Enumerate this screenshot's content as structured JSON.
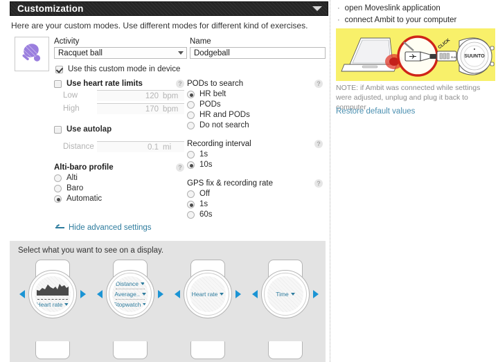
{
  "header": {
    "title": "Customization",
    "collapse_icon": "caret-down-icon"
  },
  "intro": "Here are your custom modes. Use different modes for different kind of exercises.",
  "activity": {
    "icon": "racquet-ball-icon",
    "label": "Activity",
    "value": "Racquet ball"
  },
  "name": {
    "label": "Name",
    "value": "Dodgeball"
  },
  "use_custom_mode": {
    "label": "Use this custom mode in device",
    "checked": true
  },
  "heart_rate_limits": {
    "label": "Use heart rate limits",
    "checked": false,
    "low": {
      "label": "Low",
      "value": "120",
      "unit": "bpm"
    },
    "high": {
      "label": "High",
      "value": "170",
      "unit": "bpm"
    }
  },
  "autolap": {
    "label": "Use autolap",
    "checked": false,
    "distance": {
      "label": "Distance",
      "value": "0.1",
      "unit": "mi"
    }
  },
  "alti_baro": {
    "title": "Alti-baro profile",
    "options": [
      {
        "label": "Alti",
        "selected": false
      },
      {
        "label": "Baro",
        "selected": false
      },
      {
        "label": "Automatic",
        "selected": true
      }
    ]
  },
  "pods_to_search": {
    "title": "PODs to search",
    "options": [
      {
        "label": "HR belt",
        "selected": true
      },
      {
        "label": "PODs",
        "selected": false
      },
      {
        "label": "HR and PODs",
        "selected": false
      },
      {
        "label": "Do not search",
        "selected": false
      }
    ]
  },
  "recording_interval": {
    "title": "Recording interval",
    "options": [
      {
        "label": "1s",
        "selected": false
      },
      {
        "label": "10s",
        "selected": true
      }
    ]
  },
  "gps_fix": {
    "title": "GPS fix & recording rate",
    "options": [
      {
        "label": "Off",
        "selected": false
      },
      {
        "label": "1s",
        "selected": true
      },
      {
        "label": "60s",
        "selected": false
      }
    ]
  },
  "advanced_link": {
    "label": "Hide advanced settings",
    "icon": "collapse-icon"
  },
  "display_panel": {
    "title": "Select what you want to see on a display.",
    "watches": [
      {
        "name": "watch-display-1",
        "type": "graph",
        "items": [
          {
            "label": "Heart rate",
            "dropdown": true
          }
        ]
      },
      {
        "name": "watch-display-2",
        "type": "list",
        "items": [
          {
            "label": "Distance",
            "dropdown": true
          },
          {
            "label": "Average..",
            "dropdown": true
          },
          {
            "label": "Stopwatch",
            "dropdown": true
          }
        ]
      },
      {
        "name": "watch-display-3",
        "type": "single",
        "items": [
          {
            "label": "Heart rate",
            "dropdown": true
          }
        ]
      },
      {
        "name": "watch-display-4",
        "type": "single",
        "items": [
          {
            "label": "Time",
            "dropdown": true
          }
        ]
      }
    ],
    "prev_icon": "arrow-left-icon",
    "next_icon": "arrow-right-icon"
  },
  "sidebar": {
    "bullets": [
      "open Moveslink application",
      "connect Ambit to your computer"
    ],
    "illustration_alt": "laptop-usb-ambit-watch-illustration",
    "watch_brand": "SUUNTO",
    "note": "NOTE: if Ambit was connected while settings were adjusted, unplug and plug it back to computer",
    "restore_link": "Restore default values"
  },
  "help_icon": "?",
  "colors": {
    "header_bg": "#262626",
    "link": "#2e7c9e",
    "accent_blue": "#1b94d4",
    "panel_bg": "#e3e3e3",
    "illustration_bg": "#f8f06a",
    "activity_icon": "#9a7ede"
  }
}
